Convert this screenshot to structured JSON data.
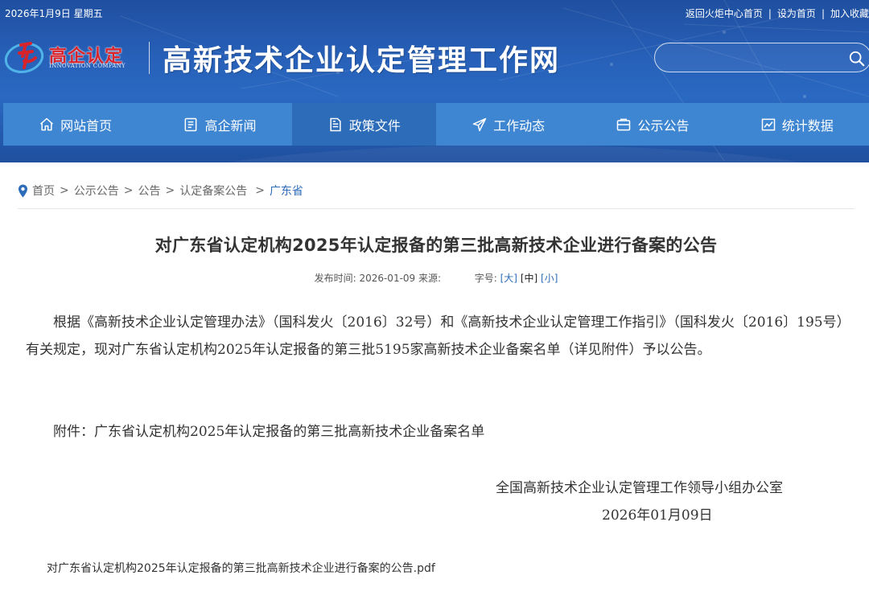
{
  "topbar": {
    "date": "2026年1月9日 星期五",
    "links": [
      "返回火炬中心首页",
      "设为首页",
      "加入收藏"
    ]
  },
  "logo": {
    "brand_cn": "高企认定",
    "brand_en": "INNOVATION COMPANY"
  },
  "site_title": "高新技术企业认定管理工作网",
  "search": {
    "value": ""
  },
  "nav": [
    {
      "label": "网站首页",
      "icon": "home-icon"
    },
    {
      "label": "高企新闻",
      "icon": "news-icon"
    },
    {
      "label": "政策文件",
      "icon": "document-icon",
      "active": true
    },
    {
      "label": "工作动态",
      "icon": "paper-plane-icon"
    },
    {
      "label": "公示公告",
      "icon": "announcement-icon"
    },
    {
      "label": "统计数据",
      "icon": "chart-icon"
    }
  ],
  "breadcrumb": {
    "items": [
      "首页",
      "公示公告",
      "公告",
      "认定备案公告"
    ],
    "current": "广东省"
  },
  "article": {
    "title": "对广东省认定机构2025年认定报备的第三批高新技术企业进行备案的公告",
    "meta": {
      "publish_label": "发布时间:",
      "publish_time": "2026-01-09",
      "source_label": "来源:",
      "fontsize_label": "字号:",
      "size_large": "大",
      "size_medium": "中",
      "size_small": "小"
    },
    "paragraph1": "根据《高新技术企业认定管理办法》（国科发火〔2016〕32号）和《高新技术企业认定管理工作指引》（国科发火〔2016〕195号）有关规定，现对广东省认定机构2025年认定报备的第三批5195家高新技术企业备案名单（详见附件）予以公告。",
    "paragraph2": "附件：广东省认定机构2025年认定报备的第三批高新技术企业备案名单",
    "signature_org": "全国高新技术企业认定管理工作领导小组办公室",
    "signature_date": "2026年01月09日",
    "attachment_file": "对广东省认定机构2025年认定报备的第三批高新技术企业进行备案的公告.pdf"
  },
  "colors": {
    "header_blue": "#2760b8",
    "nav_blue": "#3f86d2",
    "nav_active": "#2d6cb8",
    "logo_red": "#d9232b",
    "link_blue": "#2d6cb8"
  }
}
